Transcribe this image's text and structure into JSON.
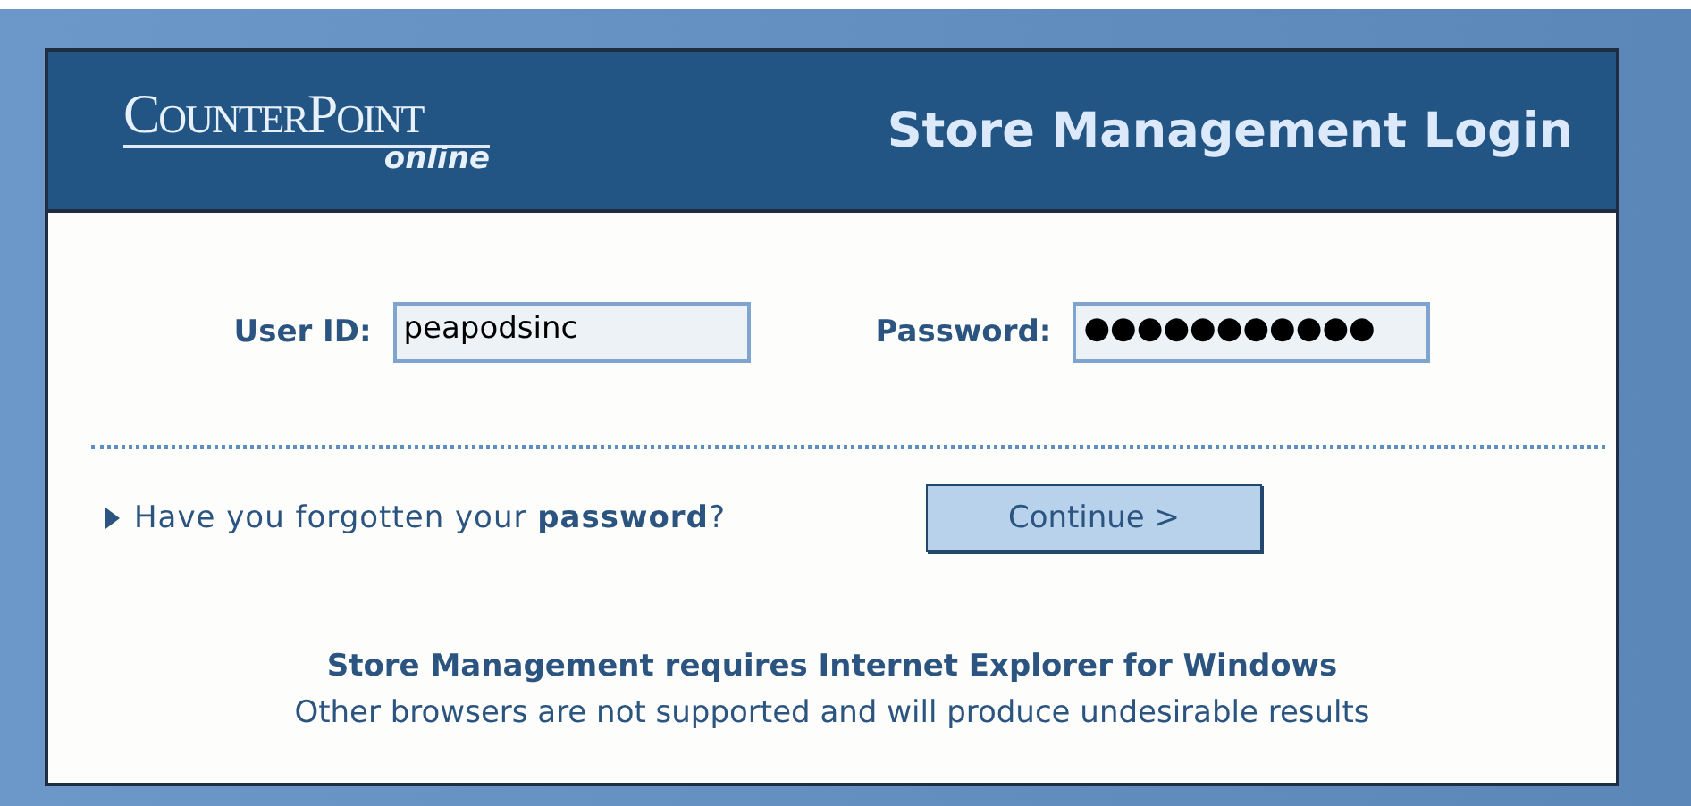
{
  "logo": {
    "brand": "CounterPoint",
    "tagline": "online"
  },
  "title": "Store Management Login",
  "fields": [
    {
      "label": "User ID:",
      "value": "peapodsinc"
    },
    {
      "label": "Password:",
      "value": "●●●●●●●●●●●"
    }
  ],
  "forgot_link": "Have you forgotten your **password**?",
  "continue_button": "Continue >",
  "notice": {
    "heading": "Store Management requires Internet Explorer for Windows",
    "text": "Other browsers are not supported and will produce undesirable results"
  }
}
